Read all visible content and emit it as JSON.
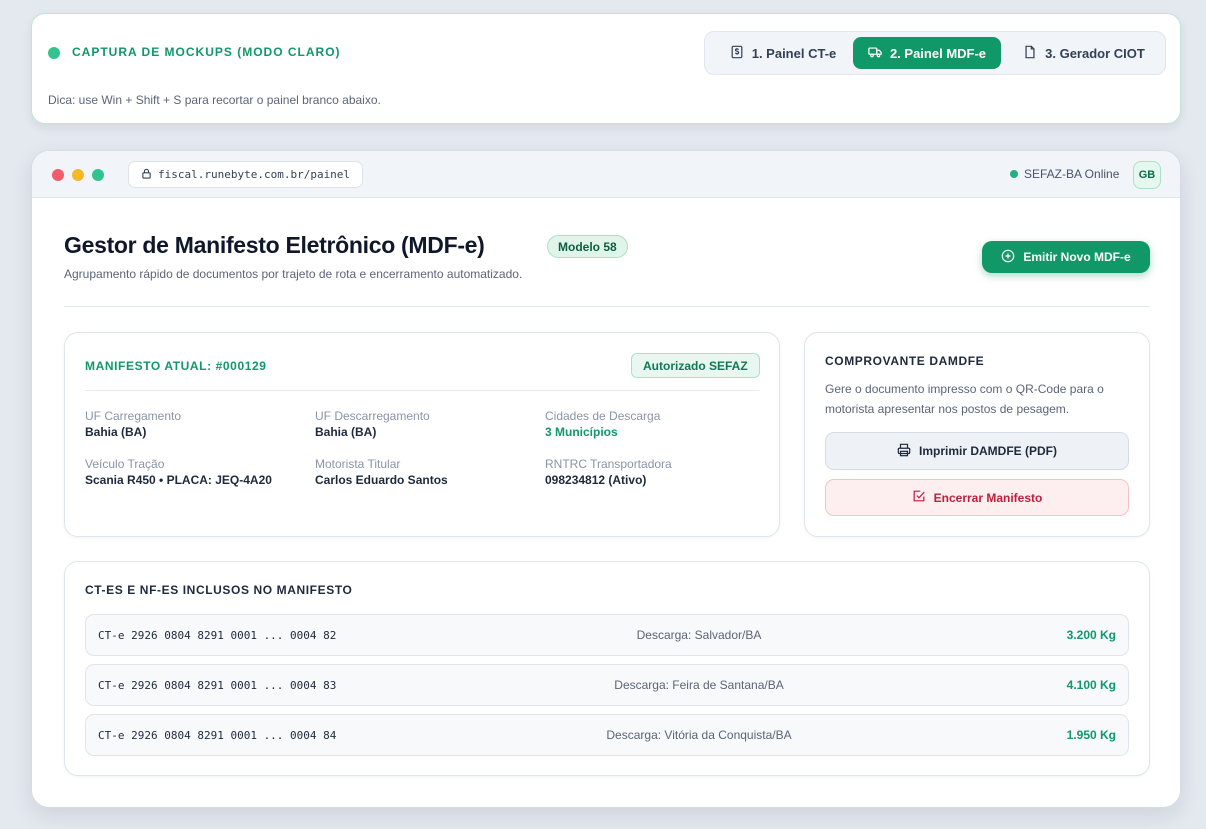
{
  "capture": {
    "title": "CAPTURA DE MOCKUPS (MODO CLARO)",
    "hint": "Dica: use Win + Shift + S para recortar o painel branco abaixo.",
    "tabs": [
      {
        "label": "1. Painel CT-e",
        "icon": "dollar-document-icon",
        "active": false
      },
      {
        "label": "2. Painel MDF-e",
        "icon": "truck-icon",
        "active": true
      },
      {
        "label": "3. Gerador CIOT",
        "icon": "document-icon",
        "active": false
      }
    ]
  },
  "browser": {
    "url": "fiscal.runebyte.com.br/painel",
    "status": "SEFAZ-BA Online",
    "avatar": "GB"
  },
  "header": {
    "title": "Gestor de Manifesto Eletrônico (MDF-e)",
    "badge": "Modelo 58",
    "subtitle": "Agrupamento rápido de documentos por trajeto de rota e encerramento automatizado.",
    "emit_label": "Emitir Novo MDF-e"
  },
  "manifest": {
    "title": "MANIFESTO ATUAL: #000129",
    "status_badge": "Autorizado SEFAZ",
    "fields": [
      {
        "label": "UF Carregamento",
        "value": "Bahia (BA)"
      },
      {
        "label": "UF Descarregamento",
        "value": "Bahia (BA)"
      },
      {
        "label": "Cidades de Descarga",
        "value": "3 Municípios"
      },
      {
        "label": "Veículo Tração",
        "value": "Scania R450 • PLACA: JEQ-4A20"
      },
      {
        "label": "Motorista Titular",
        "value": "Carlos Eduardo Santos"
      },
      {
        "label": "RNTRC Transportadora",
        "value": "098234812 (Ativo)"
      }
    ]
  },
  "damdfe": {
    "title": "COMPROVANTE DAMDFE",
    "description": "Gere o documento impresso com o QR-Code para o motorista apresentar nos postos de pesagem.",
    "print_label": "Imprimir DAMDFE (PDF)",
    "close_label": "Encerrar Manifesto"
  },
  "documents": {
    "title": "CT-ES E NF-ES INCLUSOS NO MANIFESTO",
    "rows": [
      {
        "id": "CT-e 2926 0804 8291 0001 ... 0004 82",
        "destination": "Descarga: Salvador/BA",
        "weight": "3.200 Kg"
      },
      {
        "id": "CT-e 2926 0804 8291 0001 ... 0004 83",
        "destination": "Descarga: Feira de Santana/BA",
        "weight": "4.100 Kg"
      },
      {
        "id": "CT-e 2926 0804 8291 0001 ... 0004 84",
        "destination": "Descarga: Vitória da Conquista/BA",
        "weight": "1.950 Kg"
      }
    ]
  },
  "colors": {
    "brand": "#109869",
    "danger": "#be1f3b",
    "page_background": "#e4e9f0"
  }
}
